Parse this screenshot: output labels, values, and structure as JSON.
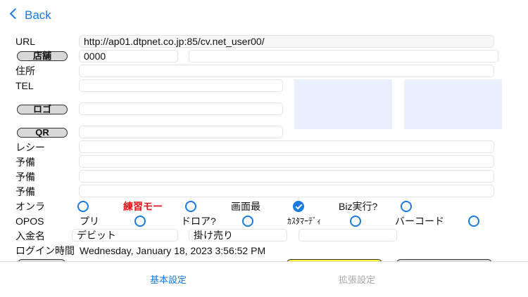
{
  "nav": {
    "back_label": "Back"
  },
  "form": {
    "url_label": "URL",
    "url_value": "http://ap01.dtpnet.co.jp:85/cv.net_user00/",
    "store_button": "店舗",
    "store_code": "0000",
    "store_name": "",
    "address_label": "住所",
    "tel_label": "TEL",
    "logo_button": "ロゴ",
    "qr_button": "QR",
    "receipt_label": "レシー",
    "spare_labels": [
      "予備",
      "予備",
      "予備"
    ]
  },
  "options": {
    "row1": [
      {
        "label": "オンラ",
        "checked": false
      },
      {
        "label": "練習モー",
        "checked": false,
        "color": "#e8141b"
      },
      {
        "label": "画面最",
        "checked": true
      },
      {
        "label": "Biz実行?",
        "checked": false
      }
    ],
    "row2": [
      {
        "label": "OPOS",
        "checked": null
      },
      {
        "label": "プリ",
        "checked": false
      },
      {
        "label": "ドロア?",
        "checked": false
      },
      {
        "label": "ｶｽﾀﾏｰﾃﾞｨ",
        "checked": false
      },
      {
        "label": "バーコード",
        "checked": false
      }
    ]
  },
  "payment": {
    "label": "入金名",
    "values": [
      "デビット",
      "掛け売り",
      ""
    ]
  },
  "login": {
    "label": "ログイン時間",
    "value": "Wednesday, January 18, 2023 3:56:52 PM"
  },
  "tabs": [
    {
      "label": "基本設定",
      "active": true
    },
    {
      "label": "拡張設定",
      "active": false
    }
  ],
  "colors": {
    "accent": "#1a7ae0",
    "inactive": "#a8a8a8"
  }
}
